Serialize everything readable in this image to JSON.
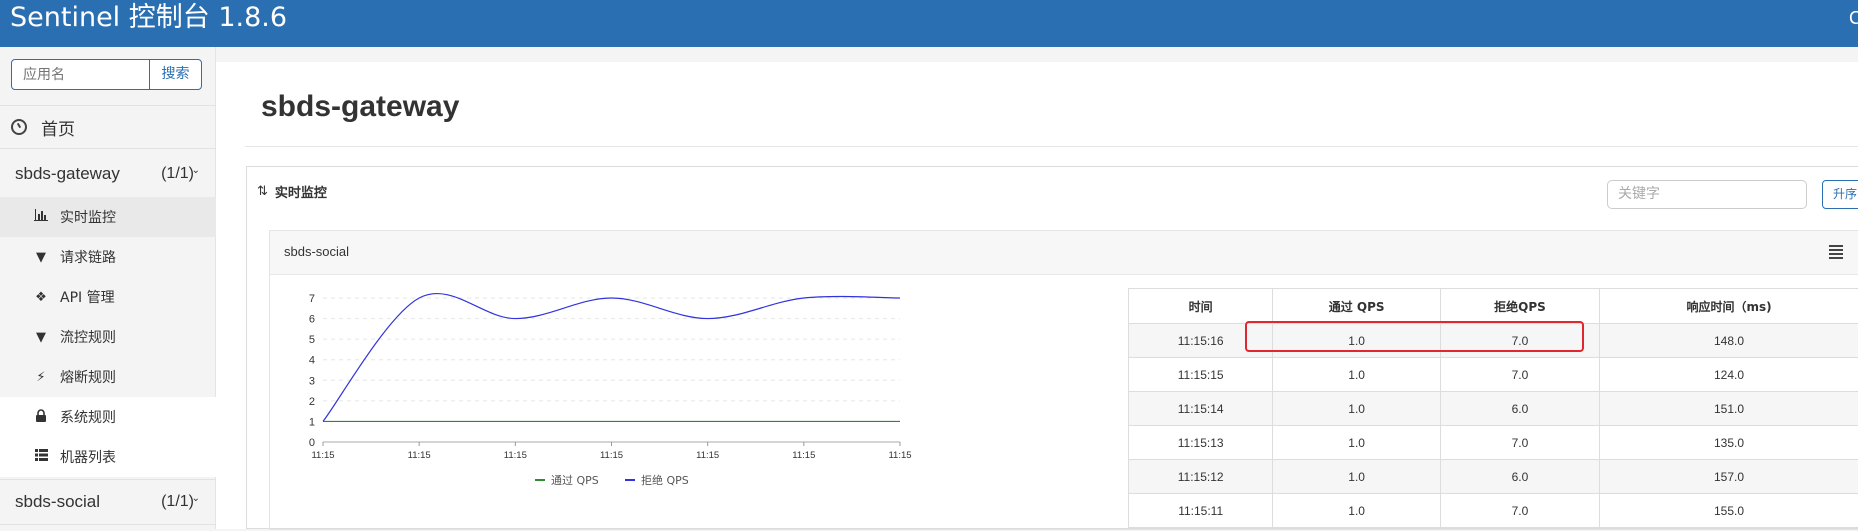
{
  "header": {
    "title": "Sentinel 控制台 1.8.6",
    "right_text": "C"
  },
  "sidebar": {
    "search_placeholder": "应用名",
    "search_button": "搜索",
    "home": "首页",
    "apps": [
      {
        "name": "sbds-gateway",
        "count": "(1/1)",
        "expanded": true
      },
      {
        "name": "sbds-social",
        "count": "(1/1)",
        "expanded": false
      }
    ],
    "sub_items": [
      {
        "label": "实时监控",
        "icon": "bar-chart-icon",
        "active": true
      },
      {
        "label": "请求链路",
        "icon": "filter-icon"
      },
      {
        "label": "API 管理",
        "icon": "tags-icon"
      },
      {
        "label": "流控规则",
        "icon": "filter-icon"
      },
      {
        "label": "熔断规则",
        "icon": "flash-icon"
      },
      {
        "label": "系统规则",
        "icon": "lock-icon"
      },
      {
        "label": "机器列表",
        "icon": "list-icon"
      }
    ]
  },
  "main": {
    "title": "sbds-gateway",
    "panel_title": "实时监控",
    "keyword_placeholder": "关键字",
    "sort_button": "升序",
    "card_title": "sbds-social",
    "table": {
      "headers": [
        "时间",
        "通过 QPS",
        "拒绝QPS",
        "响应时间（ms)"
      ],
      "rows": [
        [
          "11:15:16",
          "1.0",
          "7.0",
          "148.0"
        ],
        [
          "11:15:15",
          "1.0",
          "7.0",
          "124.0"
        ],
        [
          "11:15:14",
          "1.0",
          "6.0",
          "151.0"
        ],
        [
          "11:15:13",
          "1.0",
          "7.0",
          "135.0"
        ],
        [
          "11:15:12",
          "1.0",
          "6.0",
          "157.0"
        ],
        [
          "11:15:11",
          "1.0",
          "7.0",
          "155.0"
        ]
      ]
    }
  },
  "chart_data": {
    "type": "line",
    "x": [
      "11:15",
      "11:15",
      "11:15",
      "11:15",
      "11:15",
      "11:15",
      "11:15"
    ],
    "ylim": [
      0,
      7
    ],
    "yticks": [
      0,
      1,
      2,
      3,
      4,
      5,
      6,
      7
    ],
    "series": [
      {
        "name": "通过 QPS",
        "color": "#2e8b2e",
        "values": [
          1,
          1,
          1,
          1,
          1,
          1,
          1
        ]
      },
      {
        "name": "拒绝 QPS",
        "color": "#3333dd",
        "values": [
          1,
          7,
          6,
          7,
          6,
          7,
          7
        ]
      }
    ],
    "legend": "bottom",
    "grid": true
  }
}
